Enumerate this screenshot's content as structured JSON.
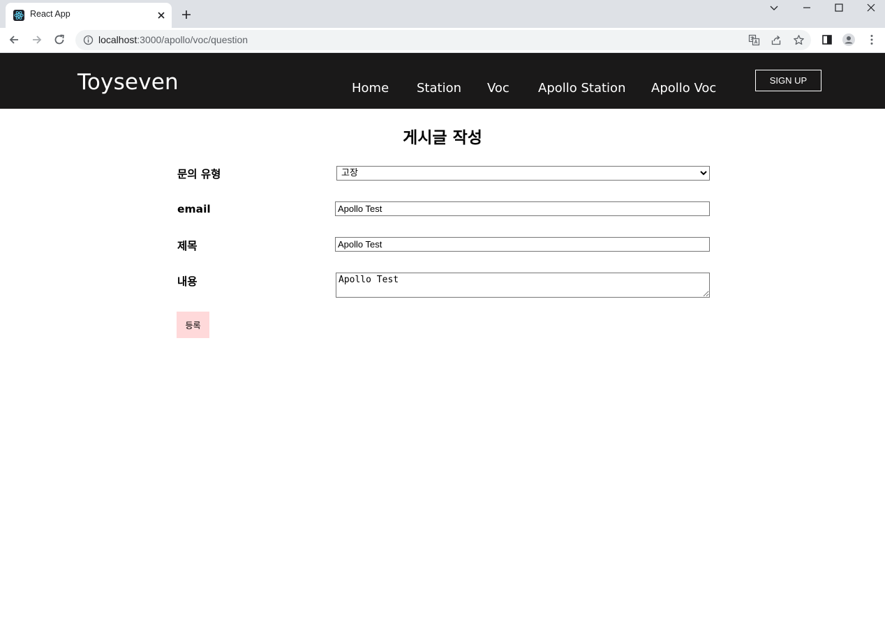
{
  "browser": {
    "tab_title": "React App",
    "url_host": "localhost",
    "url_path": ":3000/apollo/voc/question"
  },
  "header": {
    "brand": "Toyseven",
    "nav": [
      "Home",
      "Station",
      "Voc",
      "Apollo Station",
      "Apollo Voc"
    ],
    "signup_label": "SIGN UP"
  },
  "form": {
    "title": "게시글 작성",
    "type_label": "문의 유형",
    "type_value": "고장",
    "email_label": "email",
    "email_value": "Apollo Test",
    "subject_label": "제목",
    "subject_value": "Apollo Test",
    "content_label": "내용",
    "content_value": "Apollo Test",
    "submit_label": "등록"
  },
  "colors": {
    "header_bg": "#1a1919",
    "submit_bg": "#ffd9da"
  }
}
